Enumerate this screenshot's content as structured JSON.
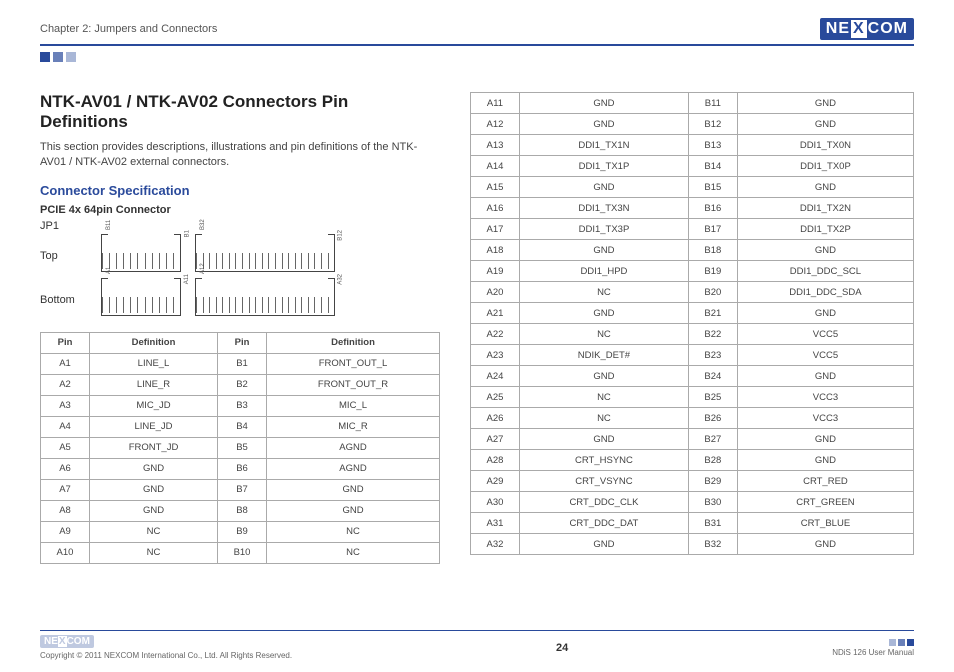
{
  "header": {
    "chapter": "Chapter 2: Jumpers and Connectors",
    "brand_left": "NE",
    "brand_mid": "X",
    "brand_right": "COM"
  },
  "title": "NTK-AV01 / NTK-AV02 Connectors Pin Definitions",
  "intro": "This section provides descriptions, illustrations and pin definitions of the NTK-AV01 / NTK-AV02 external connectors.",
  "section": "Connector Specification",
  "subhead": "PCIE 4x 64pin Connector",
  "jp": "JP1",
  "row_labels": {
    "top": "Top",
    "bottom": "Bottom"
  },
  "pin_markers": {
    "top_left_start": "B1",
    "top_left_end": "B11",
    "top_right_start": "B12",
    "top_right_end": "B32",
    "bot_left_start": "A1",
    "bot_left_end": "A11",
    "bot_right_start": "A12",
    "bot_right_end": "A32"
  },
  "table_headers": {
    "pin": "Pin",
    "def": "Definition"
  },
  "left_rows": [
    {
      "a": "A1",
      "ad": "LINE_L",
      "b": "B1",
      "bd": "FRONT_OUT_L"
    },
    {
      "a": "A2",
      "ad": "LINE_R",
      "b": "B2",
      "bd": "FRONT_OUT_R"
    },
    {
      "a": "A3",
      "ad": "MIC_JD",
      "b": "B3",
      "bd": "MIC_L"
    },
    {
      "a": "A4",
      "ad": "LINE_JD",
      "b": "B4",
      "bd": "MIC_R"
    },
    {
      "a": "A5",
      "ad": "FRONT_JD",
      "b": "B5",
      "bd": "AGND"
    },
    {
      "a": "A6",
      "ad": "GND",
      "b": "B6",
      "bd": "AGND"
    },
    {
      "a": "A7",
      "ad": "GND",
      "b": "B7",
      "bd": "GND"
    },
    {
      "a": "A8",
      "ad": "GND",
      "b": "B8",
      "bd": "GND"
    },
    {
      "a": "A9",
      "ad": "NC",
      "b": "B9",
      "bd": "NC"
    },
    {
      "a": "A10",
      "ad": "NC",
      "b": "B10",
      "bd": "NC"
    }
  ],
  "right_rows": [
    {
      "a": "A11",
      "ad": "GND",
      "b": "B11",
      "bd": "GND"
    },
    {
      "a": "A12",
      "ad": "GND",
      "b": "B12",
      "bd": "GND"
    },
    {
      "a": "A13",
      "ad": "DDI1_TX1N",
      "b": "B13",
      "bd": "DDI1_TX0N"
    },
    {
      "a": "A14",
      "ad": "DDI1_TX1P",
      "b": "B14",
      "bd": "DDI1_TX0P"
    },
    {
      "a": "A15",
      "ad": "GND",
      "b": "B15",
      "bd": "GND"
    },
    {
      "a": "A16",
      "ad": "DDI1_TX3N",
      "b": "B16",
      "bd": "DDI1_TX2N"
    },
    {
      "a": "A17",
      "ad": "DDI1_TX3P",
      "b": "B17",
      "bd": "DDI1_TX2P"
    },
    {
      "a": "A18",
      "ad": "GND",
      "b": "B18",
      "bd": "GND"
    },
    {
      "a": "A19",
      "ad": "DDI1_HPD",
      "b": "B19",
      "bd": "DDI1_DDC_SCL"
    },
    {
      "a": "A20",
      "ad": "NC",
      "b": "B20",
      "bd": "DDI1_DDC_SDA"
    },
    {
      "a": "A21",
      "ad": "GND",
      "b": "B21",
      "bd": "GND"
    },
    {
      "a": "A22",
      "ad": "NC",
      "b": "B22",
      "bd": "VCC5"
    },
    {
      "a": "A23",
      "ad": "NDIK_DET#",
      "b": "B23",
      "bd": "VCC5"
    },
    {
      "a": "A24",
      "ad": "GND",
      "b": "B24",
      "bd": "GND"
    },
    {
      "a": "A25",
      "ad": "NC",
      "b": "B25",
      "bd": "VCC3"
    },
    {
      "a": "A26",
      "ad": "NC",
      "b": "B26",
      "bd": "VCC3"
    },
    {
      "a": "A27",
      "ad": "GND",
      "b": "B27",
      "bd": "GND"
    },
    {
      "a": "A28",
      "ad": "CRT_HSYNC",
      "b": "B28",
      "bd": "GND"
    },
    {
      "a": "A29",
      "ad": "CRT_VSYNC",
      "b": "B29",
      "bd": "CRT_RED"
    },
    {
      "a": "A30",
      "ad": "CRT_DDC_CLK",
      "b": "B30",
      "bd": "CRT_GREEN"
    },
    {
      "a": "A31",
      "ad": "CRT_DDC_DAT",
      "b": "B31",
      "bd": "CRT_BLUE"
    },
    {
      "a": "A32",
      "ad": "GND",
      "b": "B32",
      "bd": "GND"
    }
  ],
  "footer": {
    "copyright": "Copyright © 2011 NEXCOM International Co., Ltd. All Rights Reserved.",
    "page": "24",
    "manual": "NDiS 126 User Manual"
  }
}
